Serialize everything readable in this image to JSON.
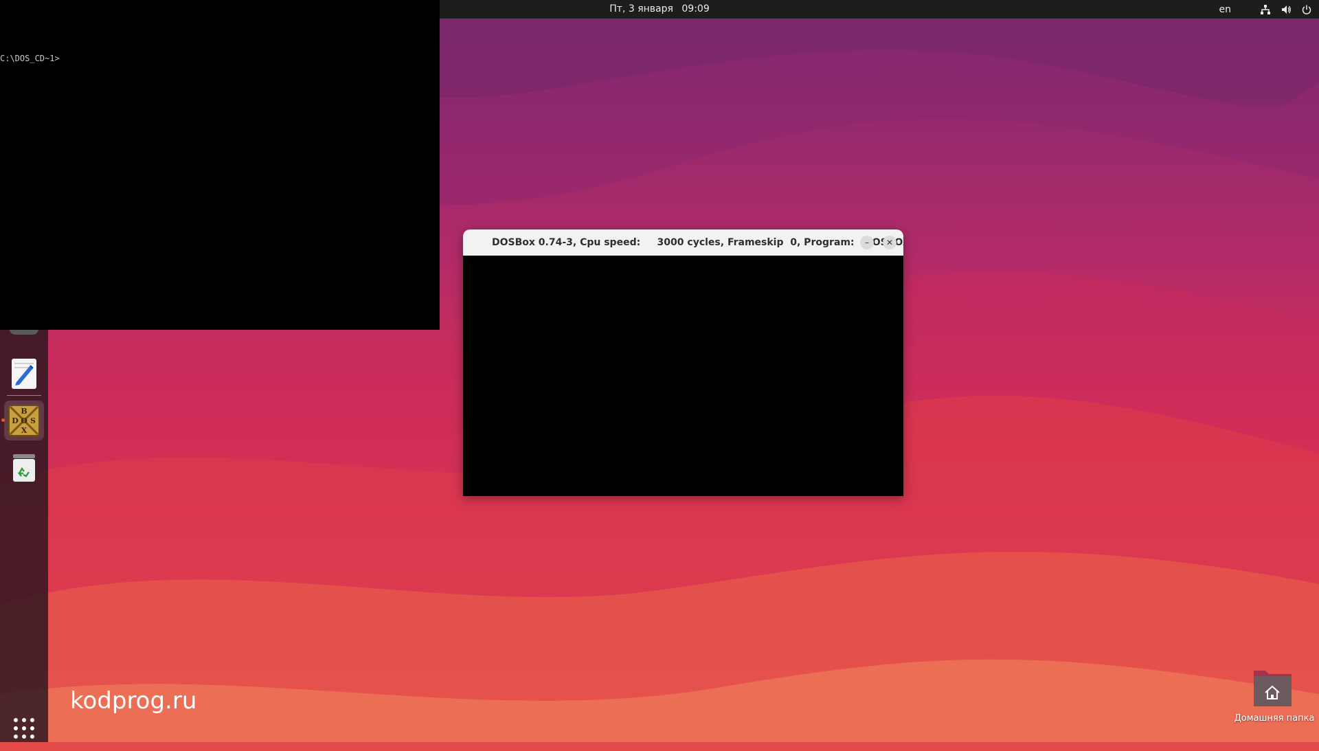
{
  "topbar": {
    "day": "Пт, 3 января",
    "time": "09:09",
    "lang": "en",
    "icons": [
      "network-icon",
      "volume-icon",
      "power-icon"
    ]
  },
  "terminal": {
    "prompt": "C:\\DOS_CD~1>"
  },
  "dosbox_window": {
    "title": "DOSBox 0.74-3, Cpu speed:     3000 cycles, Frameskip  0, Program:   DOSBOX",
    "minimize_glyph": "–",
    "close_glyph": "✕"
  },
  "dock": {
    "items": [
      "text-editor-icon",
      "dosbox-icon",
      "trash-icon"
    ],
    "apps_grid": "app-grid-icon",
    "dosbox_letters": [
      "B",
      "D",
      "O",
      "S",
      "X"
    ]
  },
  "desktop": {
    "home_folder_label": "Домашняя папка"
  },
  "watermark": "kodprog.ru",
  "colors": {
    "topbar": "#1d1d1d",
    "accent": "#e95420",
    "wallpaper_top": "#7a2a72",
    "wallpaper_bottom": "#ee6a50"
  }
}
